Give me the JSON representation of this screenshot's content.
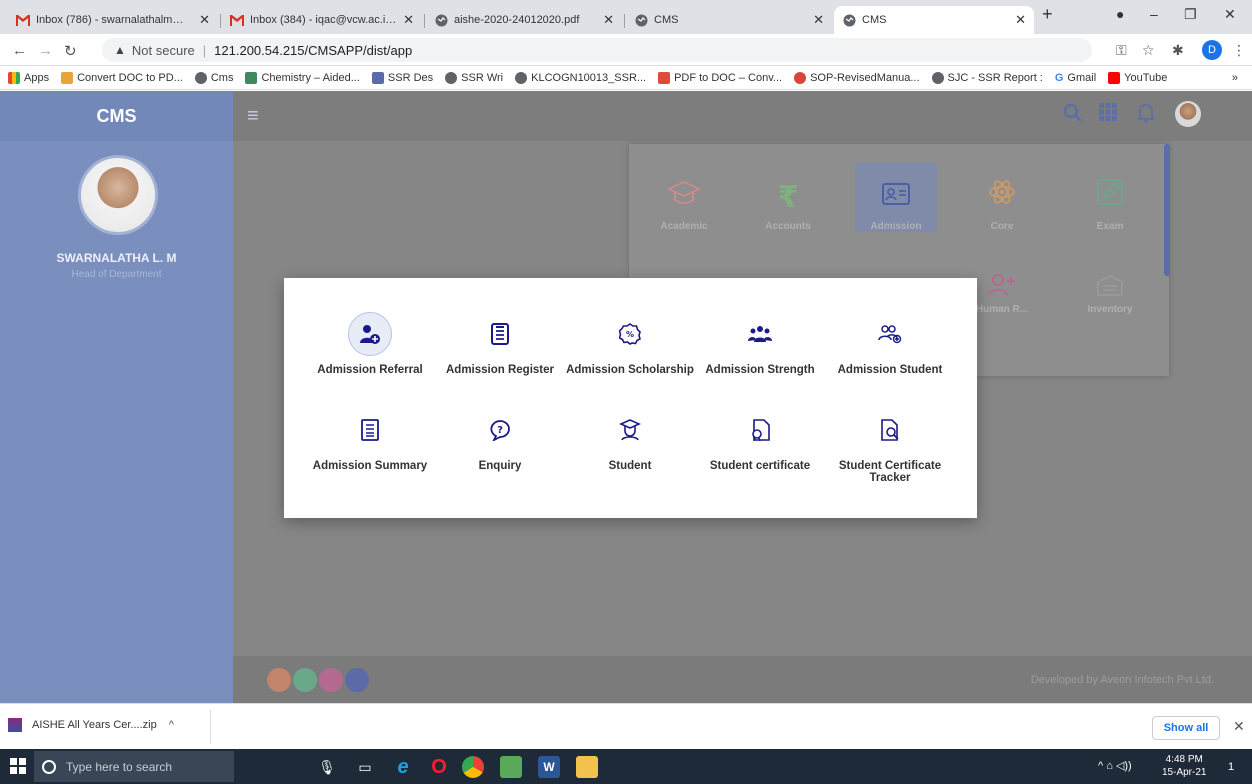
{
  "browser": {
    "tabs": [
      {
        "label": "Inbox (786) - swarnalathalm@gm",
        "icon": "gmail-icon"
      },
      {
        "label": "Inbox (384) - iqac@vcw.ac.in - V",
        "icon": "gmail-icon"
      },
      {
        "label": "aishe-2020-24012020.pdf",
        "icon": "globe-icon"
      },
      {
        "label": "CMS",
        "icon": "globe-icon"
      },
      {
        "label": "CMS",
        "icon": "globe-icon"
      }
    ],
    "not_secure": "Not secure",
    "url": "121.200.54.215/CMSAPP/dist/app",
    "profile_initial": "D",
    "bookmarks": [
      "Apps",
      "Convert DOC to PD...",
      "Cms",
      "Chemistry – Aided...",
      "SSR Des",
      "SSR Wri",
      "KLCOGN10013_SSR...",
      "PDF to DOC – Conv...",
      "SOP-RevisedManua...",
      "SJC - SSR Report :",
      "Gmail",
      "YouTube"
    ],
    "more": "»"
  },
  "app": {
    "brand": "CMS",
    "user_name": "SWARNALATHA L. M",
    "user_role": "Head of Department",
    "footer_credit": "Developed by Aveon Infotech Pvt Ltd."
  },
  "modules": [
    {
      "label": "Academic",
      "icon": "graduation-cap-icon",
      "color": "#c98a8a"
    },
    {
      "label": "Accounts",
      "icon": "rupee-icon",
      "color": "#7fb07f"
    },
    {
      "label": "Admission",
      "icon": "id-card-icon",
      "color": "#7a8ed0"
    },
    {
      "label": "Core",
      "icon": "atom-icon",
      "color": "#c99a6a"
    },
    {
      "label": "Exam",
      "icon": "pencil-square-icon",
      "color": "#6aa88a"
    },
    {
      "label": "Human R...",
      "icon": "add-user-icon",
      "color": "#b46a90"
    },
    {
      "label": "Inventory",
      "icon": "warehouse-icon",
      "color": "#9a9a9a"
    }
  ],
  "submenu": [
    {
      "label": "Admission Referral",
      "icon": "referral-icon"
    },
    {
      "label": "Admission Register",
      "icon": "register-icon"
    },
    {
      "label": "Admission Scholarship",
      "icon": "scholarship-icon"
    },
    {
      "label": "Admission Strength",
      "icon": "strength-icon"
    },
    {
      "label": "Admission Student",
      "icon": "students-icon"
    },
    {
      "label": "Admission Summary",
      "icon": "summary-icon"
    },
    {
      "label": "Enquiry",
      "icon": "enquiry-icon"
    },
    {
      "label": "Student",
      "icon": "student-icon"
    },
    {
      "label": "Student certificate",
      "icon": "certificate-icon"
    },
    {
      "label": "Student Certificate Tracker",
      "icon": "certificate-tracker-icon"
    }
  ],
  "download": {
    "file": "AISHE All Years Cer....zip",
    "show_all": "Show all"
  },
  "taskbar": {
    "search_placeholder": "Type here to search",
    "time": "4:48 PM",
    "date": "15-Apr-21",
    "notifications": "1"
  }
}
